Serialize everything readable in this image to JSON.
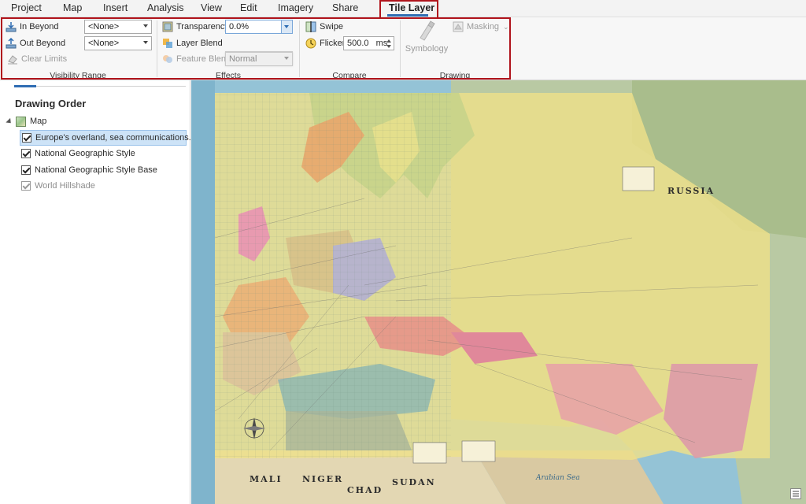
{
  "tabs": [
    {
      "label": "Project"
    },
    {
      "label": "Map"
    },
    {
      "label": "Insert"
    },
    {
      "label": "Analysis"
    },
    {
      "label": "View"
    },
    {
      "label": "Edit"
    },
    {
      "label": "Imagery"
    },
    {
      "label": "Share"
    },
    {
      "label": "Tile Layer"
    }
  ],
  "ribbon": {
    "visibility_range": {
      "group_label": "Visibility Range",
      "in_beyond_label": "In Beyond",
      "in_beyond_value": "<None>",
      "out_beyond_label": "Out Beyond",
      "out_beyond_value": "<None>",
      "clear_limits_label": "Clear Limits"
    },
    "effects": {
      "group_label": "Effects",
      "transparency_label": "Transparency",
      "transparency_value": "0.0%",
      "transparency_level": 0,
      "layer_blend_label": "Layer Blend",
      "feature_blend_label": "Feature Blend",
      "feature_blend_value": "Normal"
    },
    "compare": {
      "group_label": "Compare",
      "swipe_label": "Swipe",
      "flicker_label": "Flicker",
      "flicker_value": "500.0",
      "flicker_unit": "ms"
    },
    "drawing": {
      "group_label": "Drawing",
      "symbology_label": "Symbology",
      "masking_label": "Masking"
    }
  },
  "contents": {
    "title": "Drawing Order",
    "map_label": "Map",
    "layers": [
      {
        "label": "Europe's overland, sea communications.",
        "checked": true,
        "selected": true
      },
      {
        "label": "National Geographic Style",
        "checked": true,
        "selected": false
      },
      {
        "label": "National Geographic Style Base",
        "checked": true,
        "selected": false
      },
      {
        "label": "World Hillshade",
        "checked": true,
        "selected": false
      }
    ]
  },
  "map": {
    "labels": {
      "russia": "RUSSIA",
      "mali": "MALI",
      "niger": "NIGER",
      "chad": "CHAD",
      "sudan": "SUDAN",
      "arabian_sea": "Arabian Sea"
    }
  },
  "colors": {
    "accent": "#2f6db3",
    "highlight_outline": "#b0141c",
    "selection": "#cde3f7"
  }
}
